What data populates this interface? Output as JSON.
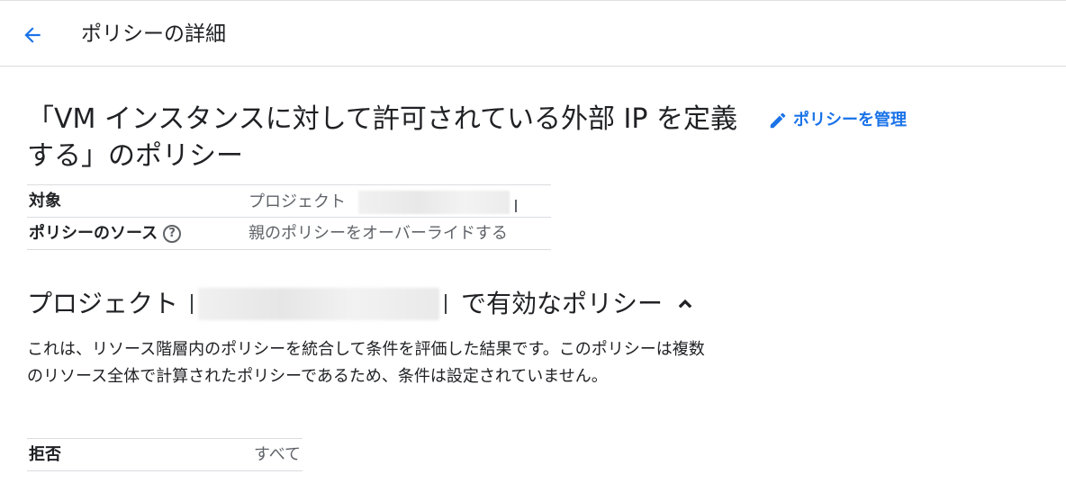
{
  "header": {
    "back_icon": "arrow-left-icon",
    "title": "ポリシーの詳細"
  },
  "policy": {
    "title": "「VM インスタンスに対して許可されている外部 IP を定義する」のポリシー",
    "manage_label": "ポリシーを管理",
    "manage_icon": "pencil-icon"
  },
  "details": {
    "rows": [
      {
        "label": "対象",
        "value": "プロジェクト"
      },
      {
        "label": "ポリシーのソース",
        "value": "親のポリシーをオーバーライドする"
      }
    ],
    "help_icon": "help-circle-icon"
  },
  "effective": {
    "heading_prefix": "プロジェクト",
    "heading_suffix": "で有効なポリシー",
    "collapse_icon": "chevron-up-icon",
    "description": "これは、リソース階層内のポリシーを統合して条件を評価した結果です。このポリシーは複数のリソース全体で計算されたポリシーであるため、条件は設定されていません。",
    "rule": {
      "label": "拒否",
      "value": "すべて"
    }
  },
  "colors": {
    "accent": "#1a73e8",
    "text": "#202124",
    "secondary_text": "#5f6368",
    "divider": "#dadce0"
  }
}
